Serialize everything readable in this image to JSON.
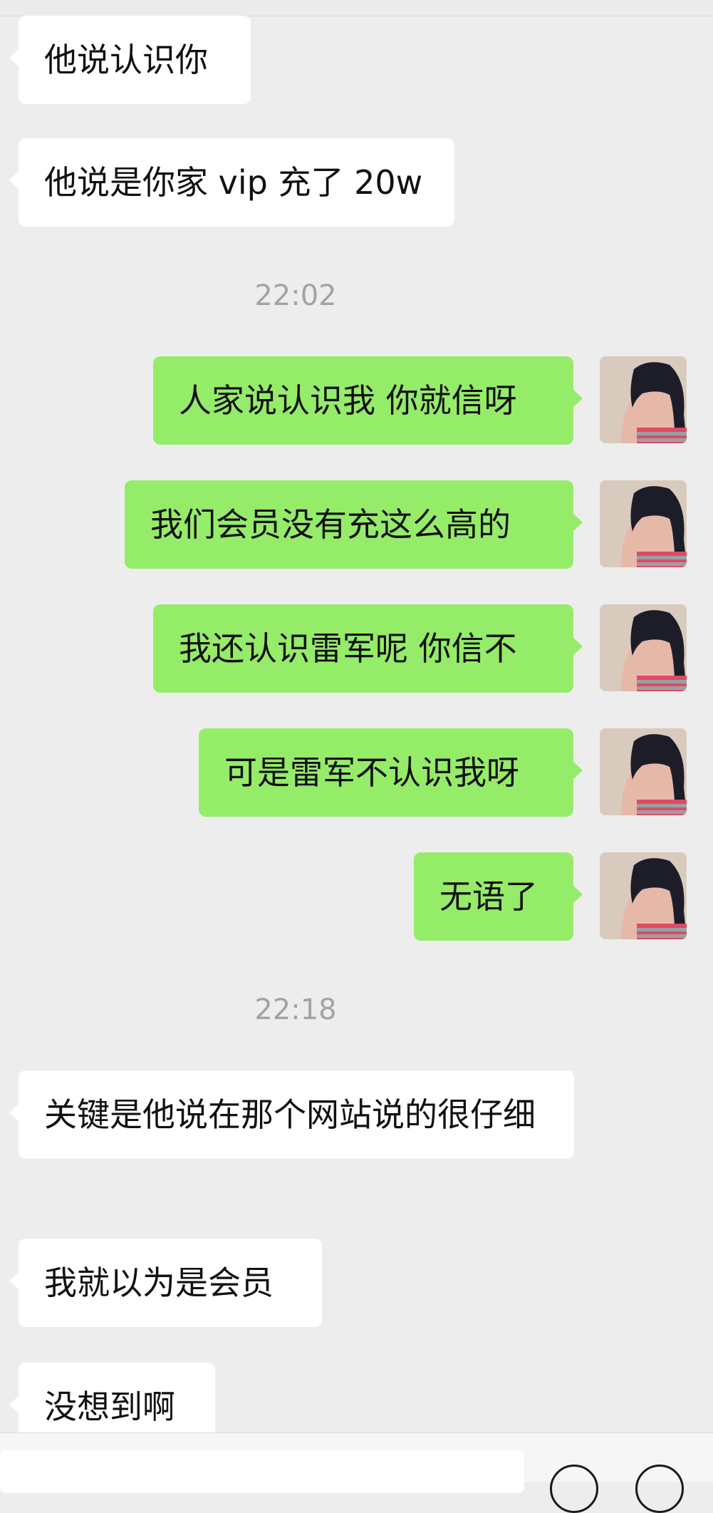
{
  "messages_top": [
    {
      "text": "他说认识你"
    },
    {
      "text": "他说是你家 vip 充了 20w"
    }
  ],
  "timestamps": [
    "22:02",
    "22:18"
  ],
  "outgoing": [
    {
      "text": "人家说认识我 你就信呀"
    },
    {
      "text": "我们会员没有充这么高的"
    },
    {
      "text": "我还认识雷军呢 你信不"
    },
    {
      "text": "可是雷军不认识我呀"
    },
    {
      "text": "无语了"
    }
  ],
  "messages_bottom": [
    {
      "text": "关键是他说在那个网站说的很仔细"
    },
    {
      "text": "我就以为是会员"
    },
    {
      "text": "没想到啊"
    }
  ],
  "colors": {
    "outgoing_bubble": "#95ec69",
    "incoming_bubble": "#ffffff",
    "background": "#ededed"
  }
}
